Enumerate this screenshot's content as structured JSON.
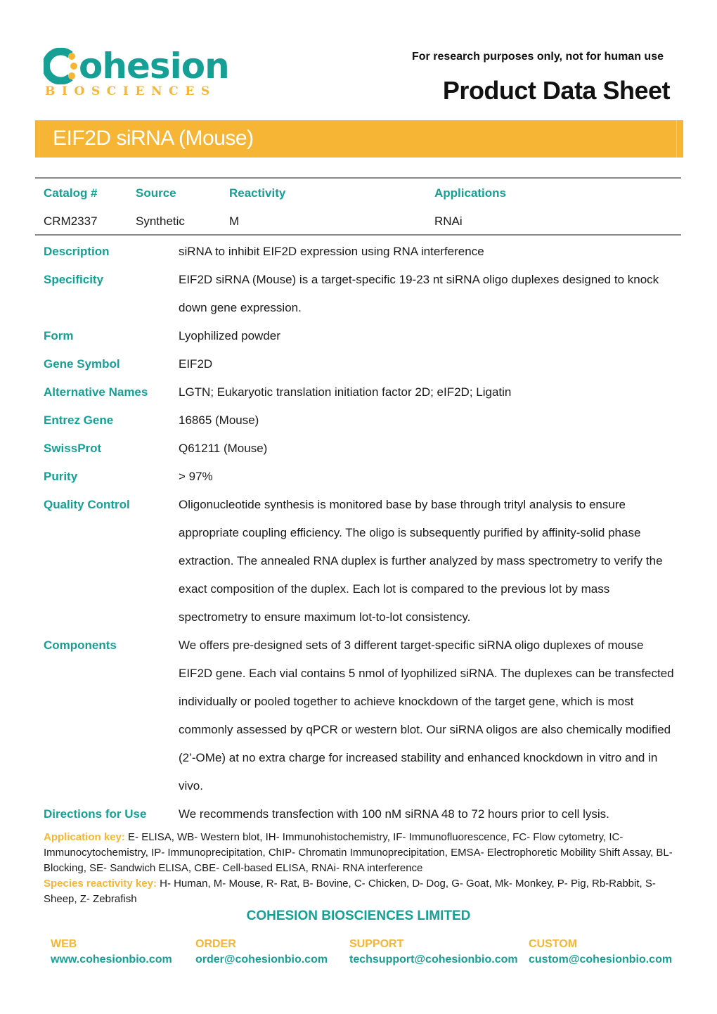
{
  "header": {
    "logo_text": "ohesion",
    "logo_subtext": "BIOSCIENCES",
    "disclaimer": "For research purposes only, not for human use",
    "sheet_title": "Product Data Sheet"
  },
  "product": {
    "title": "EIF2D siRNA (Mouse)"
  },
  "summary": {
    "headers": [
      "Catalog #",
      "Source",
      "Reactivity",
      "Applications"
    ],
    "values": [
      "CRM2337",
      "Synthetic",
      "M",
      "RNAi"
    ]
  },
  "properties": [
    {
      "label": "Description",
      "value": "siRNA to inhibit EIF2D expression using RNA interference"
    },
    {
      "label": "Specificity",
      "value": "EIF2D siRNA (Mouse) is a target-specific 19-23 nt siRNA oligo duplexes designed to knock down gene expression."
    },
    {
      "label": "Form",
      "value": "Lyophilized powder"
    },
    {
      "label": "Gene Symbol",
      "value": "EIF2D"
    },
    {
      "label": "Alternative Names",
      "value": "LGTN; Eukaryotic translation initiation factor 2D; eIF2D; Ligatin"
    },
    {
      "label": "Entrez Gene",
      "value": "16865 (Mouse)"
    },
    {
      "label": "SwissProt",
      "value": "Q61211 (Mouse)"
    },
    {
      "label": "Purity",
      "value": "> 97%"
    },
    {
      "label": "Quality Control",
      "value": "Oligonucleotide synthesis is monitored base by base through trityl analysis to ensure appropriate coupling efficiency. The oligo is subsequently purified by affinity-solid phase extraction. The annealed RNA duplex is further analyzed by mass spectrometry to verify the exact composition of the duplex. Each lot is compared to the previous lot by mass spectrometry to ensure maximum lot-to-lot consistency."
    },
    {
      "label": "Components",
      "value": "We offers pre-designed sets of 3 different target-specific siRNA oligo duplexes of mouse EIF2D gene. Each vial contains 5 nmol of lyophilized siRNA. The duplexes can be transfected individually or pooled together to achieve knockdown of the target gene, which is most commonly assessed by qPCR or western blot. Our siRNA oligos are also chemically modified (2’-OMe) at no extra charge for increased stability and enhanced knockdown in vitro and in vivo."
    },
    {
      "label": "Directions for Use",
      "value": "We recommends transfection with 100 nM siRNA 48 to 72 hours prior to cell lysis."
    }
  ],
  "keys": {
    "application_label": "Application key:",
    "application_text": " E- ELISA, WB- Western blot, IH- Immunohistochemistry, IF- Immunofluorescence, FC- Flow cytometry, IC- Immunocytochemistry, IP- Immunoprecipitation, ChIP- Chromatin Immunoprecipitation, EMSA- Electrophoretic Mobility Shift Assay, BL- Blocking, SE- Sandwich ELISA, CBE- Cell-based ELISA, RNAi- RNA interference",
    "species_label": "Species reactivity key:",
    "species_text": " H- Human, M- Mouse, R- Rat, B- Bovine, C- Chicken, D- Dog, G- Goat, Mk- Monkey, P- Pig, Rb-Rabbit, S- Sheep, Z- Zebrafish"
  },
  "footer": {
    "company": "COHESION BIOSCIENCES LIMITED",
    "contacts": [
      {
        "label": "WEB",
        "value": "www.cohesionbio.com"
      },
      {
        "label": "ORDER",
        "value": "order@cohesionbio.com"
      },
      {
        "label": "SUPPORT",
        "value": "techsupport@cohesionbio.com"
      },
      {
        "label": "CUSTOM",
        "value": "custom@cohesionbio.com"
      }
    ]
  },
  "colors": {
    "brand_teal": "#16a095",
    "brand_orange": "#f6b534"
  }
}
